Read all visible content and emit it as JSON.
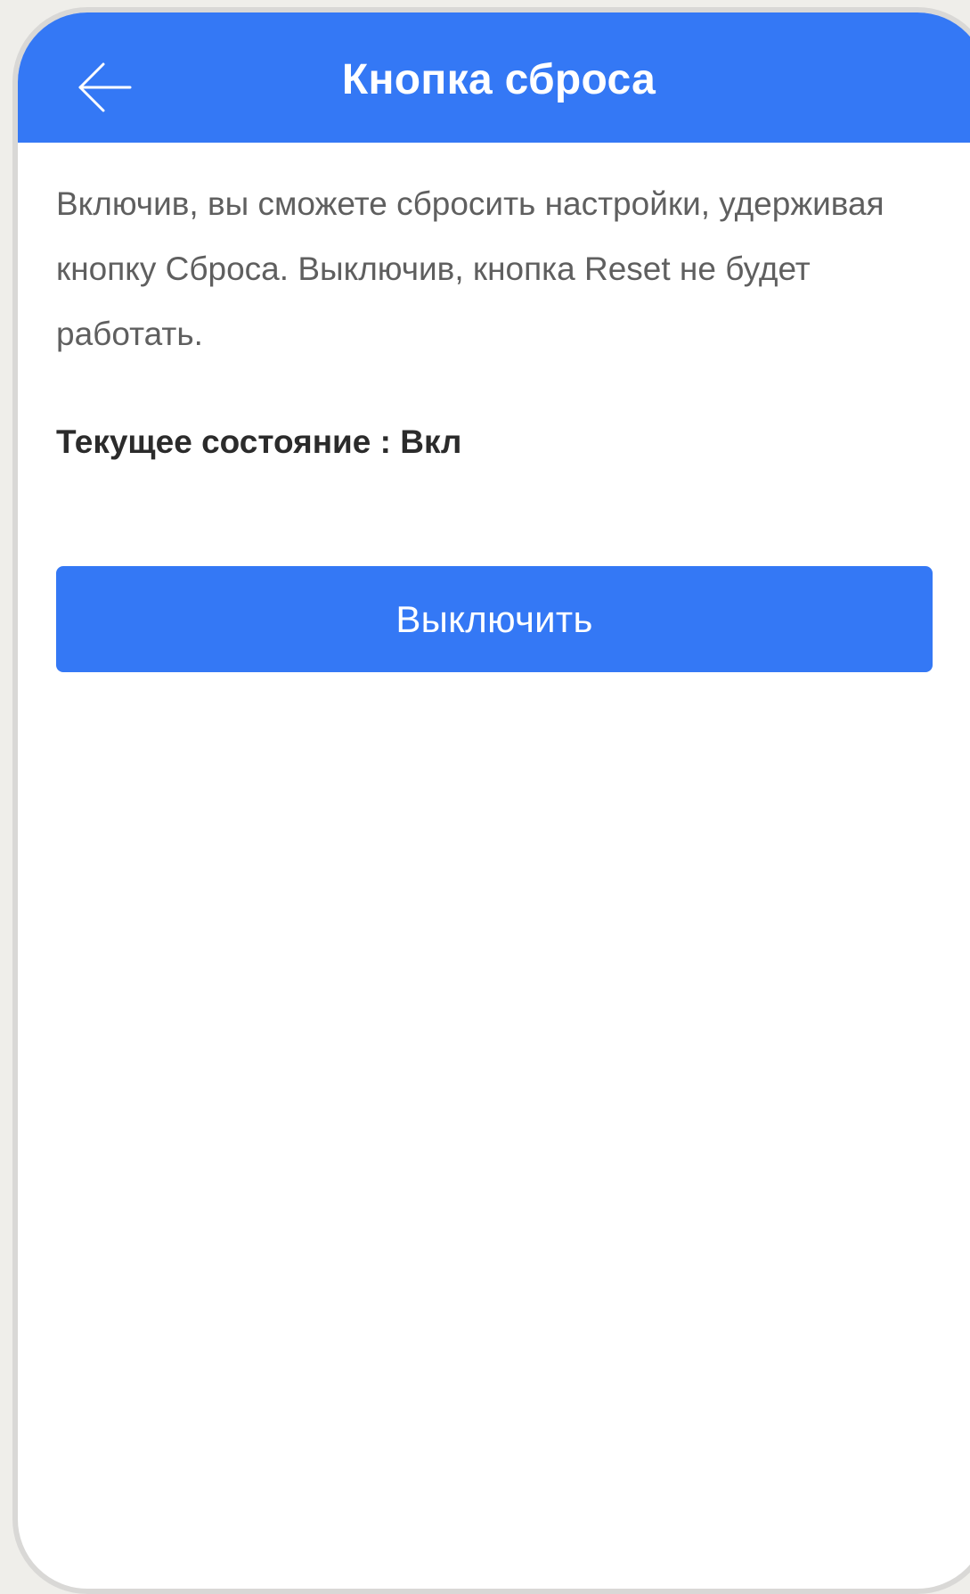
{
  "header": {
    "title": "Кнопка сброса",
    "back_icon": "arrow-left-icon"
  },
  "main": {
    "description": "Включив, вы сможете сбросить настройки, удерживая кнопку Сброса. Выключив, кнопка Reset не будет работать.",
    "status_label": "Текущее состояние : Вкл",
    "toggle_button_label": "Выключить"
  },
  "colors": {
    "accent": "#3478f5",
    "background": "#ffffff",
    "text_secondary": "#5f5f5f",
    "text_primary": "#2b2b2b"
  }
}
